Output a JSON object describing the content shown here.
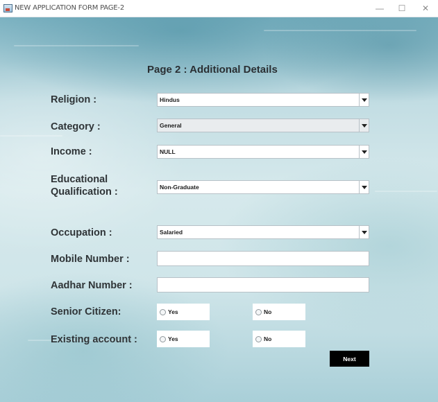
{
  "window": {
    "title": "NEW APPLICATION FORM PAGE-2",
    "minimize_symbol": "—",
    "maximize_symbol": "☐",
    "close_symbol": "✕"
  },
  "form": {
    "page_title": "Page 2 :  Additional Details",
    "religion": {
      "label": "Religion :",
      "value": "Hindus"
    },
    "category": {
      "label": "Category :",
      "value": "General"
    },
    "income": {
      "label": "Income :",
      "value": "NULL"
    },
    "education": {
      "label_line1": "Educational",
      "label_line2": "Qualification :",
      "value": "Non-Graduate"
    },
    "occupation": {
      "label": "Occupation :",
      "value": "Salaried"
    },
    "mobile": {
      "label": "Mobile Number :",
      "value": ""
    },
    "aadhar": {
      "label": "Aadhar Number :",
      "value": ""
    },
    "senior_citizen": {
      "label": "Senior Citizen:",
      "yes": "Yes",
      "no": "No"
    },
    "existing_account": {
      "label": "Existing account :",
      "yes": "Yes",
      "no": "No"
    },
    "next_label": "Next"
  },
  "colors": {
    "background_accent": "#9cc8d3",
    "button_bg": "#000000",
    "button_text": "#ffffff"
  },
  "icons": [
    "java-app-icon",
    "minimize-icon",
    "maximize-icon",
    "close-icon",
    "dropdown-arrow-icon",
    "radio-icon"
  ]
}
